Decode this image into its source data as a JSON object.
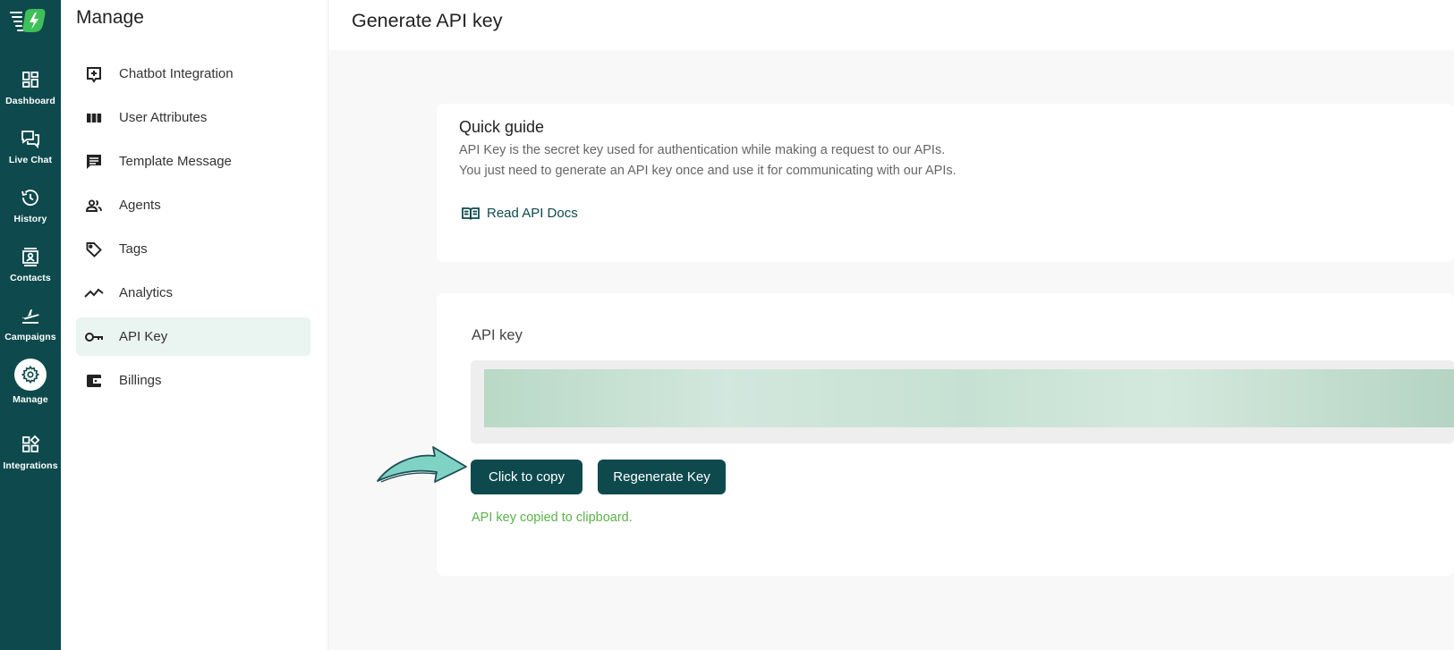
{
  "rail": {
    "items": [
      {
        "label": "Dashboard",
        "icon": "dashboard-icon"
      },
      {
        "label": "Live Chat",
        "icon": "live-chat-icon"
      },
      {
        "label": "History",
        "icon": "history-icon"
      },
      {
        "label": "Contacts",
        "icon": "contacts-icon"
      },
      {
        "label": "Campaigns",
        "icon": "campaigns-icon"
      },
      {
        "label": "Manage",
        "icon": "gear-icon",
        "active": true
      },
      {
        "label": "Integrations",
        "icon": "integrations-icon"
      }
    ]
  },
  "panel": {
    "title": "Manage",
    "items": [
      {
        "label": "Chatbot Integration",
        "icon": "chatbot-icon"
      },
      {
        "label": "User Attributes",
        "icon": "columns-icon"
      },
      {
        "label": "Template Message",
        "icon": "message-icon"
      },
      {
        "label": "Agents",
        "icon": "agents-icon"
      },
      {
        "label": "Tags",
        "icon": "tag-icon"
      },
      {
        "label": "Analytics",
        "icon": "analytics-icon"
      },
      {
        "label": "API Key",
        "icon": "key-icon",
        "active": true
      },
      {
        "label": "Billings",
        "icon": "wallet-icon"
      }
    ]
  },
  "header": {
    "title": "Generate API key"
  },
  "guide": {
    "title": "Quick guide",
    "line1": "API Key is the secret key used for authentication while making a request to our APIs.",
    "line2": "You just need to generate an API key once and use it for communicating with our APIs.",
    "docs_label": "Read API Docs"
  },
  "api_key": {
    "label": "API key",
    "copy_label": "Click to copy",
    "regenerate_label": "Regenerate Key",
    "status": "API key copied to clipboard."
  },
  "colors": {
    "brand": "#0e4a4d",
    "active_bg": "#eaf4f1",
    "success": "#5ab34a",
    "arrow": "#7fd3c5"
  }
}
